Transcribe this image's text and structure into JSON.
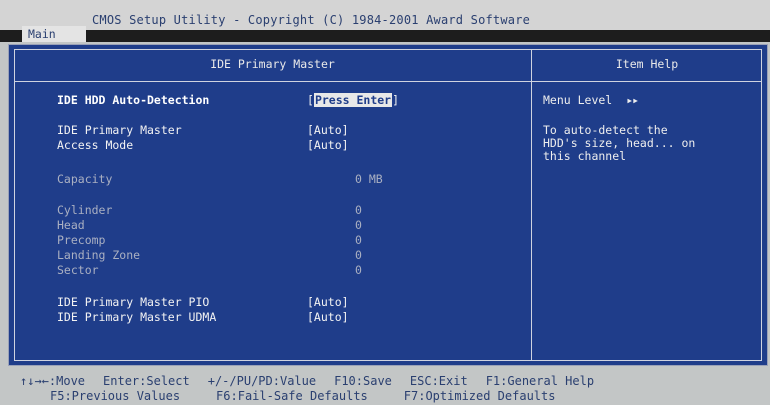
{
  "window": {
    "title": "CMOS Setup Utility - Copyright (C) 1984-2001 Award Software",
    "menu_tab": "Main"
  },
  "panel": {
    "title": "IDE Primary Master",
    "help_title": "Item Help"
  },
  "settings": {
    "auto_detect": {
      "label": "IDE HDD Auto-Detection",
      "value": "Press Enter",
      "open": "[",
      "close": "]"
    },
    "primary_master": {
      "label": "IDE Primary Master",
      "value": "[Auto]"
    },
    "access_mode": {
      "label": "Access Mode",
      "value": "[Auto]"
    },
    "capacity": {
      "label": "Capacity",
      "value": "0 MB"
    },
    "cylinder": {
      "label": "Cylinder",
      "value": "0"
    },
    "head": {
      "label": "Head",
      "value": "0"
    },
    "precomp": {
      "label": "Precomp",
      "value": "0"
    },
    "landing_zone": {
      "label": "Landing Zone",
      "value": "0"
    },
    "sector": {
      "label": "Sector",
      "value": "0"
    },
    "pio": {
      "label": "IDE Primary Master PIO",
      "value": "[Auto]"
    },
    "udma": {
      "label": "IDE Primary Master UDMA",
      "value": "[Auto]"
    }
  },
  "help": {
    "menu_level": "Menu Level",
    "menu_level_arrows": "▸▸",
    "lines": [
      "To auto-detect the",
      "HDD's size, head... on",
      "this channel"
    ]
  },
  "footer": {
    "row1": [
      "↑↓→←:Move",
      "Enter:Select",
      "+/-/PU/PD:Value",
      "F10:Save",
      "ESC:Exit",
      "F1:General Help"
    ],
    "row2": [
      "F5:Previous Values",
      "F6:Fail-Safe Defaults",
      "F7:Optimized Defaults"
    ]
  },
  "colors": {
    "screen_bg": "#1f3d8a",
    "chrome_bg": "#c3c6c6",
    "highlight": "#e8e8e8"
  }
}
